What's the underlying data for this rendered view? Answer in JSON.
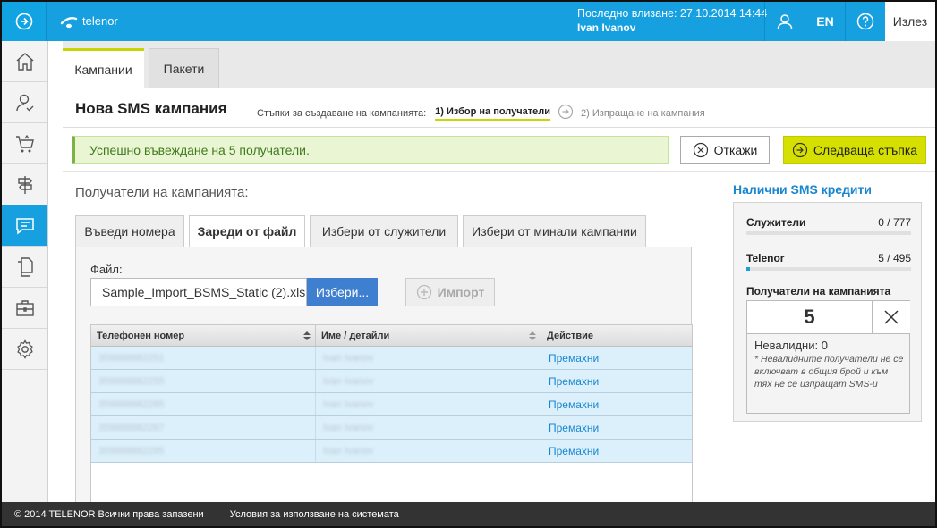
{
  "app": {
    "brand": "telenor"
  },
  "header": {
    "last_login_label": "Последно влизане: 27.10.2014 14:44",
    "user_name": "Ivan Ivanov",
    "lang": "EN",
    "logout": "Излез"
  },
  "sidebar": {
    "items": [
      {
        "icon": "home-icon"
      },
      {
        "icon": "user-check-icon"
      },
      {
        "icon": "cart-icon"
      },
      {
        "icon": "signpost-icon"
      },
      {
        "icon": "sms-chat-icon",
        "active": true
      },
      {
        "icon": "documents-icon"
      },
      {
        "icon": "briefcase-icon"
      },
      {
        "icon": "gear-icon"
      }
    ]
  },
  "tabs": {
    "campaigns": "Кампании",
    "packages": "Пакети"
  },
  "page": {
    "title": "Нова SMS кампания",
    "steps_label": "Стъпки за създаване на кампанията:",
    "step1": "1) Избор на получатели",
    "step2": "2) Изпращане на кампания"
  },
  "alert": {
    "success": "Успешно въвеждане на 5 получатели."
  },
  "buttons": {
    "cancel": "Откажи",
    "next": "Следваща стъпка",
    "choose": "Избери...",
    "import": "Импорт"
  },
  "recipients": {
    "section_title": "Получатели на кампанията:",
    "tabs": [
      "Въведи номера",
      "Зареди от файл",
      "Избери от служители",
      "Избери от минали кампании"
    ],
    "file_label": "Файл:",
    "file_value": "Sample_Import_BSMS_Static (2).xls"
  },
  "table": {
    "columns": [
      "Телефонен номер",
      "Име / детайли",
      "Действие"
    ],
    "rows": [
      {
        "phone": "359888882251",
        "name": "Ivan Ivanov",
        "action": "Премахни"
      },
      {
        "phone": "359888882255",
        "name": "Ivan Ivanov",
        "action": "Премахни"
      },
      {
        "phone": "359888882285",
        "name": "Ivan Ivanov",
        "action": "Премахни"
      },
      {
        "phone": "359888882267",
        "name": "Ivan Ivanov",
        "action": "Премахни"
      },
      {
        "phone": "359888882295",
        "name": "Ivan Ivanov",
        "action": "Премахни"
      }
    ]
  },
  "credits": {
    "title": "Налични SMS кредити",
    "employees": {
      "label": "Служители",
      "value": "0 / 777",
      "fill_fraction": 0
    },
    "telenor": {
      "label": "Telenor",
      "value": "5 / 495",
      "fill_fraction": 0.02
    },
    "recipients_label": "Получатели на кампанията",
    "recipients_count": "5",
    "invalid": "Невалидни: 0",
    "note": "* Невалидните получатели не се включват в общия брой и към тях не се изпращат SMS-и"
  },
  "footer": {
    "copyright": "© 2014 TELENOR Всички права запазени",
    "terms": "Условия за използване на системата"
  },
  "colors": {
    "accent": "#16a0e0",
    "lime": "#d6e000",
    "success_bg": "#eaf6d3"
  }
}
